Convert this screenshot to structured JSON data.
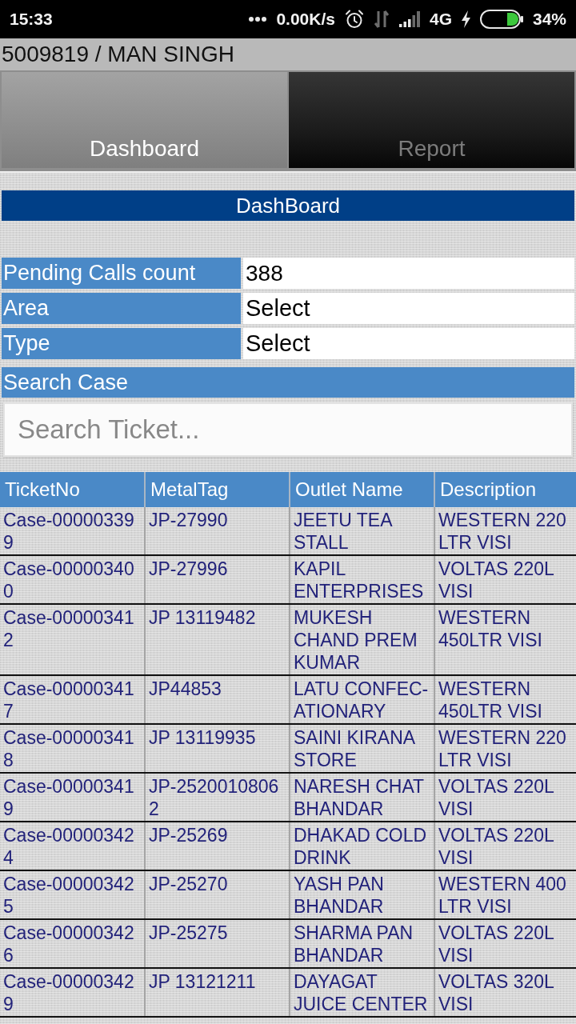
{
  "status_bar": {
    "time": "15:33",
    "network_speed": "0.00K/s",
    "network_type": "4G",
    "battery": "34%"
  },
  "user_bar": {
    "title": "5009819 / MAN SINGH"
  },
  "tabs": [
    {
      "label": "Dashboard",
      "selected": true
    },
    {
      "label": "Report",
      "selected": false
    }
  ],
  "dashboard": {
    "title": "DashBoard",
    "fields": [
      {
        "label": "Pending Calls count",
        "kind": "value",
        "value": "388"
      },
      {
        "label": "Area",
        "kind": "dropdown",
        "value": "Select"
      },
      {
        "label": "Type",
        "kind": "dropdown",
        "value": "Select"
      }
    ],
    "search_label": "Search Case",
    "search": {
      "placeholder": "Search Ticket..."
    }
  },
  "table": {
    "columns": [
      "TicketNo",
      "MetalTag",
      "Outlet Name",
      "Description"
    ],
    "rows": [
      [
        "Case-000003399",
        "JP-27990",
        "JEETU TEA STALL",
        "WESTERN 220 LTR VISI"
      ],
      [
        "Case-000003400",
        "JP-27996",
        "KAPIL ENTERPRISES",
        "VOLTAS 220L VISI"
      ],
      [
        "Case-000003412",
        "JP 13119482",
        "MUKESH CHAND PREM KUMAR",
        "WESTERN 450LTR VISI"
      ],
      [
        "Case-000003417",
        "JP44853",
        "LATU CONFEC-ATIONARY",
        "WESTERN 450LTR VISI"
      ],
      [
        "Case-000003418",
        "JP 13119935",
        "SAINI KIRANA STORE",
        "WESTERN 220 LTR VISI"
      ],
      [
        "Case-000003419",
        "JP-25200108062",
        "NARESH CHAT BHANDAR",
        "VOLTAS 220L VISI"
      ],
      [
        "Case-000003424",
        "JP-25269",
        "DHAKAD COLD DRINK",
        "VOLTAS 220L VISI"
      ],
      [
        "Case-000003425",
        "JP-25270",
        "YASH PAN BHANDAR",
        "WESTERN 400 LTR VISI"
      ],
      [
        "Case-000003426",
        "JP-25275",
        "SHARMA PAN BHANDAR",
        "VOLTAS 220L VISI"
      ],
      [
        "Case-000003429",
        "JP 13121211",
        "DAYAGAT JUICE CENTER",
        "VOLTAS 320L VISI"
      ]
    ]
  }
}
